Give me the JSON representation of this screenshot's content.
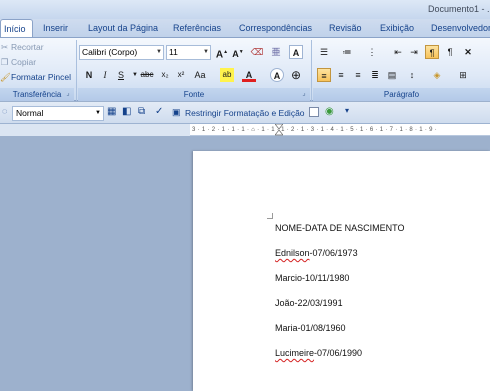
{
  "window": {
    "title": "Documento1 - ."
  },
  "tabs": [
    {
      "label": "Início",
      "active": true
    },
    {
      "label": "Inserir"
    },
    {
      "label": "Layout da Página"
    },
    {
      "label": "Referências"
    },
    {
      "label": "Correspondências"
    },
    {
      "label": "Revisão"
    },
    {
      "label": "Exibição"
    },
    {
      "label": "Desenvolvedor"
    }
  ],
  "clipboard": {
    "cut": "Recortar",
    "copy": "Copiar",
    "format_painter": "Formatar Pincel",
    "group_label": "Transferência"
  },
  "font": {
    "family": "Calibri (Corpo)",
    "size": "11",
    "group_label": "Fonte",
    "grow_glyph": "A",
    "shrink_glyph": "A",
    "clear_glyph": "A",
    "bold": "N",
    "italic": "I",
    "underline": "S",
    "strike": "abc",
    "subscript": "x₂",
    "superscript": "x²",
    "case": "Aa",
    "highlight": "ab",
    "color": "A"
  },
  "paragraph": {
    "group_label": "Parágrafo"
  },
  "quickbar": {
    "style": "Normal",
    "restrict": "Restringir Formatação e Edição"
  },
  "ruler": {
    "text": "3 · 1 · 2 · 1 · 1 · 1 · ⌂ · 1 · 1 · 1 · 2 · 1 · 3 · 1 · 4 · 1 · 5 · 1 · 6 · 1 · 7 · 1 · 8 · 1 · 9 ·"
  },
  "document": {
    "heading": "NOME-DATA DE NASCIMENTO",
    "rows": [
      {
        "name": "Ednilson",
        "date": "-07/06/1973",
        "spell_error": true
      },
      {
        "name": "Marcio",
        "date": "-10/11/1980",
        "spell_error": false
      },
      {
        "name": "João",
        "date": "-22/03/1991",
        "spell_error": false
      },
      {
        "name": "Maria",
        "date": "-01/08/1960",
        "spell_error": false
      },
      {
        "name": "Lucimeire",
        "date": "-07/06/1990",
        "spell_error": true
      }
    ]
  },
  "colors": {
    "ribbon_text": "#15428b",
    "workspace": "#9db1cd",
    "spell_underline": "#d42020"
  }
}
